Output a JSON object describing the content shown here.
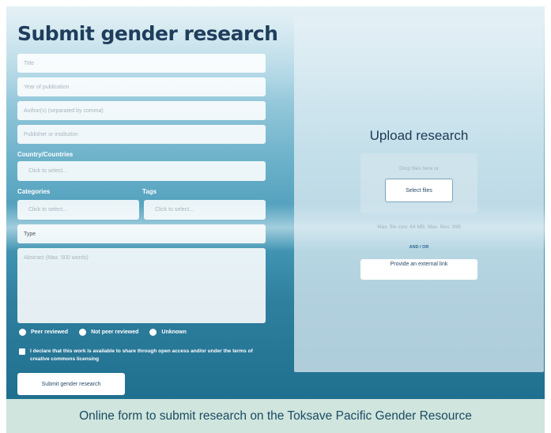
{
  "form": {
    "title": "Submit gender research",
    "fields": {
      "title_placeholder": "Title",
      "year_placeholder": "Year of publication",
      "authors_placeholder": "Author(s) (separated by comma)",
      "publisher_placeholder": "Publisher or institution",
      "country_label": "Country/Countries",
      "country_placeholder": "Click to select...",
      "categories_label": "Categories",
      "categories_placeholder": "Click to select...",
      "tags_label": "Tags",
      "tags_placeholder": "Click to select...",
      "type_value": "Type",
      "abstract_placeholder": "Abstract (Max. 500 words)"
    },
    "radios": [
      {
        "label": "Peer reviewed"
      },
      {
        "label": "Not peer reviewed"
      },
      {
        "label": "Unknown"
      }
    ],
    "declaration": "I declare that this work is available to share through open access and/or under the terms of creative commons licensing",
    "submit_label": "Submit gender research"
  },
  "upload": {
    "title": "Upload research",
    "drop_text": "Drop files here or",
    "select_files_label": "Select files",
    "max_text": "Max. file size: 64 MB. Max. files: 999",
    "and_or": "AND / OR",
    "external_link_label": "Provide an external link"
  },
  "caption": "Online form to submit research on the Toksave Pacific Gender Resource"
}
